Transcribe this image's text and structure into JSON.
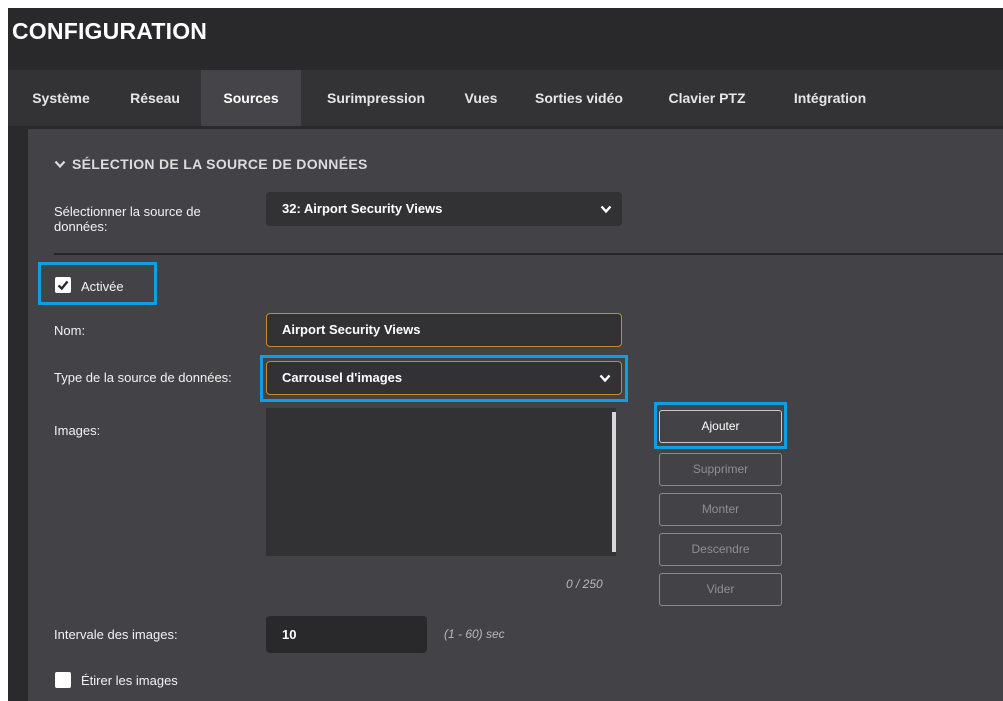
{
  "app": {
    "title": "CONFIGURATION"
  },
  "tabs": [
    {
      "label": "Système",
      "active": false
    },
    {
      "label": "Réseau",
      "active": false
    },
    {
      "label": "Sources",
      "active": true
    },
    {
      "label": "Surimpression",
      "active": false
    },
    {
      "label": "Vues",
      "active": false
    },
    {
      "label": "Sorties vidéo",
      "active": false
    },
    {
      "label": "Clavier PTZ",
      "active": false
    },
    {
      "label": "Intégration",
      "active": false
    }
  ],
  "section": {
    "header": "SÉLECTION DE LA SOURCE DE DONNÉES",
    "header_icon": "chevron-down-icon",
    "source_select": {
      "label": "Sélectionner la source de données:",
      "value": "32: Airport Security Views"
    },
    "enabled": {
      "label": "Activée",
      "checked": true
    },
    "name": {
      "label": "Nom:",
      "value": "Airport Security Views"
    },
    "type": {
      "label": "Type de la source de données:",
      "value": "Carrousel d'images"
    },
    "images": {
      "label": "Images:",
      "count": "0 / 250",
      "items": []
    },
    "buttons": {
      "add": "Ajouter",
      "delete": "Supprimer",
      "up": "Monter",
      "down": "Descendre",
      "clear": "Vider"
    },
    "interval": {
      "label": "Intervale des images:",
      "value": "10",
      "hint": "(1 - 60) sec"
    },
    "stretch": {
      "label": "Étirer les images",
      "checked": false
    }
  },
  "colors": {
    "highlight": "#0d9ee3",
    "focus_border": "#c98a2a",
    "panel": "#434347",
    "background": "#2a2a2c"
  }
}
